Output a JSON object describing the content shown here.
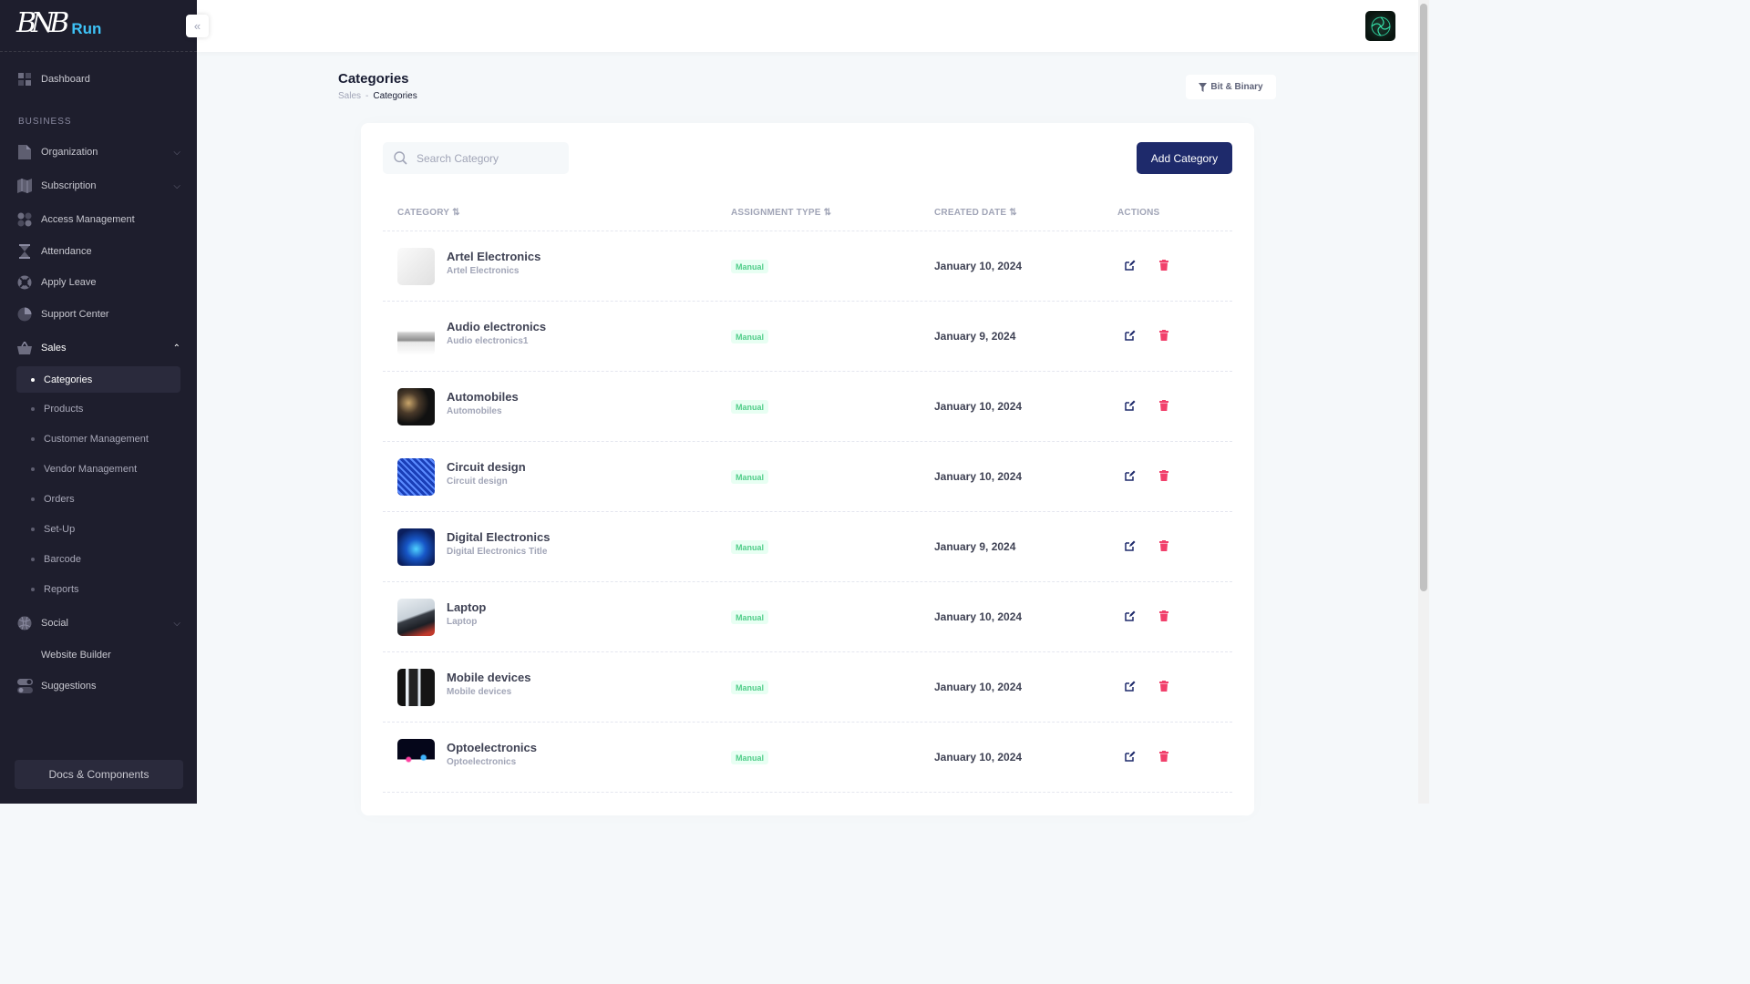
{
  "sidebar": {
    "logo_mark": "BNB",
    "logo_text": "Run",
    "dashboard": "Dashboard",
    "section_business": "BUSINESS",
    "organization": "Organization",
    "subscription": "Subscription",
    "access_management": "Access Management",
    "attendance": "Attendance",
    "apply_leave": "Apply Leave",
    "support_center": "Support Center",
    "sales": "Sales",
    "sales_children": [
      "Categories",
      "Products",
      "Customer Management",
      "Vendor Management",
      "Orders",
      "Set-Up",
      "Barcode",
      "Reports"
    ],
    "social": "Social",
    "website_builder": "Website Builder",
    "suggestions": "Suggestions",
    "docs_button": "Docs & Components"
  },
  "page": {
    "title": "Categories",
    "breadcrumb": [
      "Sales",
      "-",
      "Categories"
    ],
    "filter_label": "Bit & Binary"
  },
  "search": {
    "placeholder": "Search Category"
  },
  "add_button": "Add Category",
  "table": {
    "headers": {
      "category": "CATEGORY",
      "assignment_type": "ASSIGNMENT TYPE",
      "created_date": "CREATED DATE",
      "actions": "ACTIONS"
    },
    "rows": [
      {
        "name": "Artel Electronics",
        "subtitle": "Artel Electronics",
        "type": "Manual",
        "date": "January 10, 2024",
        "thumb": "hair-dryer"
      },
      {
        "name": "Audio electronics",
        "subtitle": "Audio electronics1",
        "type": "Manual",
        "date": "January 9, 2024",
        "thumb": "audio-amplifier"
      },
      {
        "name": "Automobiles",
        "subtitle": "Automobiles",
        "type": "Manual",
        "date": "January 10, 2024",
        "thumb": "car-parts"
      },
      {
        "name": "Circuit design",
        "subtitle": "Circuit design",
        "type": "Manual",
        "date": "January 10, 2024",
        "thumb": "circuit-board"
      },
      {
        "name": "Digital Electronics",
        "subtitle": "Digital Electronics Title",
        "type": "Manual",
        "date": "January 9, 2024",
        "thumb": "digital-chip"
      },
      {
        "name": "Laptop",
        "subtitle": "Laptop",
        "type": "Manual",
        "date": "January 10, 2024",
        "thumb": "laptop"
      },
      {
        "name": "Mobile devices",
        "subtitle": "Mobile devices",
        "type": "Manual",
        "date": "January 10, 2024",
        "thumb": "smartphones"
      },
      {
        "name": "Optoelectronics",
        "subtitle": "Optoelectronics",
        "type": "Manual",
        "date": "January 10, 2024",
        "thumb": "opto-lights"
      }
    ]
  },
  "colors": {
    "sidebar_bg": "#1e1e2d",
    "primary_button": "#1e2a6b",
    "badge_text": "#50cd89",
    "badge_bg": "#e8fff3",
    "delete_icon": "#f1416c",
    "edit_icon": "#1e2a6b"
  }
}
